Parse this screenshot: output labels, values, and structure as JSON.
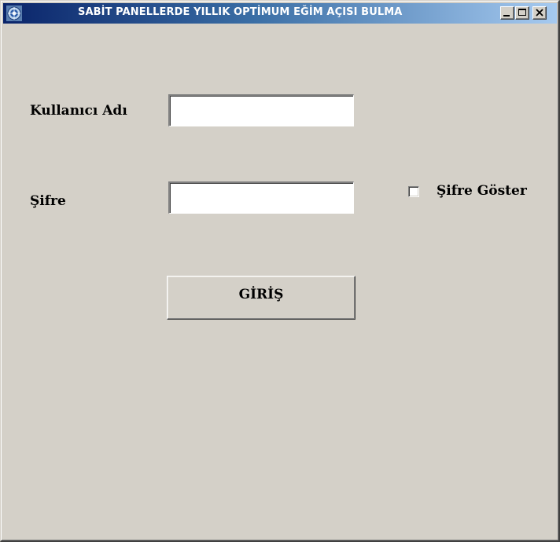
{
  "window": {
    "title": "SABİT PANELLERDE YILLIK OPTİMUM EĞİM AÇISI BULMA",
    "icon": "app-globe-icon",
    "controls": [
      "minimize-icon",
      "maximize-icon",
      "close-icon"
    ]
  },
  "form": {
    "username_label": "Kullanıcı Adı",
    "username_value": "",
    "password_label": "Şifre",
    "password_value": "",
    "show_password_label": "Şifre Göster",
    "show_password_checked": false,
    "login_button_label": "GİRİŞ"
  },
  "colors": {
    "window_background": "#d4d0c8",
    "titlebar_start": "#0a246a",
    "titlebar_end": "#a6caf0"
  }
}
